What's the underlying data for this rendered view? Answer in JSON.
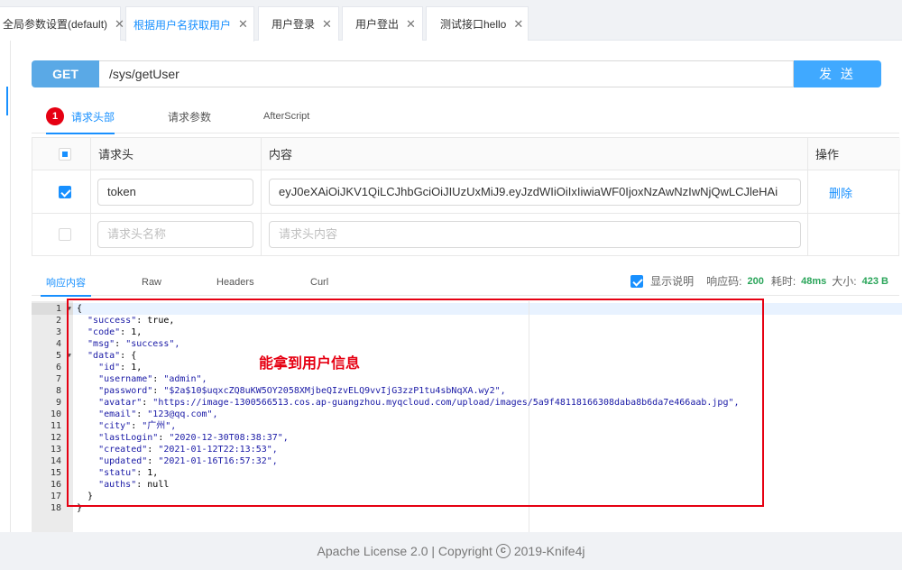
{
  "tabs": [
    {
      "label": "全局参数设置(default)",
      "close": "✕"
    },
    {
      "label": "根据用户名获取用户",
      "close": "✕"
    },
    {
      "label": "用户登录",
      "close": "✕"
    },
    {
      "label": "用户登出",
      "close": "✕"
    },
    {
      "label": "测试接口hello",
      "close": "✕"
    }
  ],
  "request": {
    "method": "GET",
    "url": "/sys/getUser",
    "send_label": "发 送"
  },
  "request_tabs": {
    "badge": "1",
    "headers": "请求头部",
    "params": "请求参数",
    "after_script": "AfterScript"
  },
  "header_table": {
    "col_header": "请求头",
    "col_content": "内容",
    "col_action": "操作",
    "row": {
      "name": "token",
      "value": "eyJ0eXAiOiJKV1QiLCJhbGciOiJIUzUxMiJ9.eyJzdWIiOiIxIiwiaWF0IjoxNzAwNzIwNjQwLCJleHAi",
      "delete_label": "删除"
    },
    "new_row": {
      "name_placeholder": "请求头名称",
      "value_placeholder": "请求头内容"
    }
  },
  "response_tabs": {
    "content": "响应内容",
    "raw": "Raw",
    "headers": "Headers",
    "curl": "Curl"
  },
  "response_stats": {
    "show_desc_label": "显示说明",
    "code_label": "响应码:",
    "code": "200",
    "time_label": "耗时:",
    "time": "48ms",
    "size_label": "大小:",
    "size": "423 B"
  },
  "response_lines": [
    "{",
    "  \"success\": true,",
    "  \"code\": 1,",
    "  \"msg\": \"success\",",
    "  \"data\": {",
    "    \"id\": 1,",
    "    \"username\": \"admin\",",
    "    \"password\": \"$2a$10$uqxcZQ8uKW5OY2058XMjbeQIzvELQ9vvIjG3zzP1tu4sbNqXA.wy2\",",
    "    \"avatar\": \"https://image-1300566513.cos.ap-guangzhou.myqcloud.com/upload/images/5a9f48118166308daba8b6da7e466aab.jpg\",",
    "    \"email\": \"123@qq.com\",",
    "    \"city\": \"广州\",",
    "    \"lastLogin\": \"2020-12-30T08:38:37\",",
    "    \"created\": \"2021-01-12T22:13:53\",",
    "    \"updated\": \"2021-01-16T16:57:32\",",
    "    \"statu\": 1,",
    "    \"auths\": null",
    "  }",
    "}"
  ],
  "annotation": "能拿到用户信息",
  "footer": {
    "left": "Apache License 2.0 | Copyright",
    "symbol": "c",
    "right": "2019-",
    "brand": "Knife4j"
  },
  "colors": {
    "accent": "#1890ff",
    "method_bg": "#5aa9e6",
    "send_bg": "#40a9ff",
    "highlight_red": "#e60012",
    "status_green": "#2aa55a"
  }
}
